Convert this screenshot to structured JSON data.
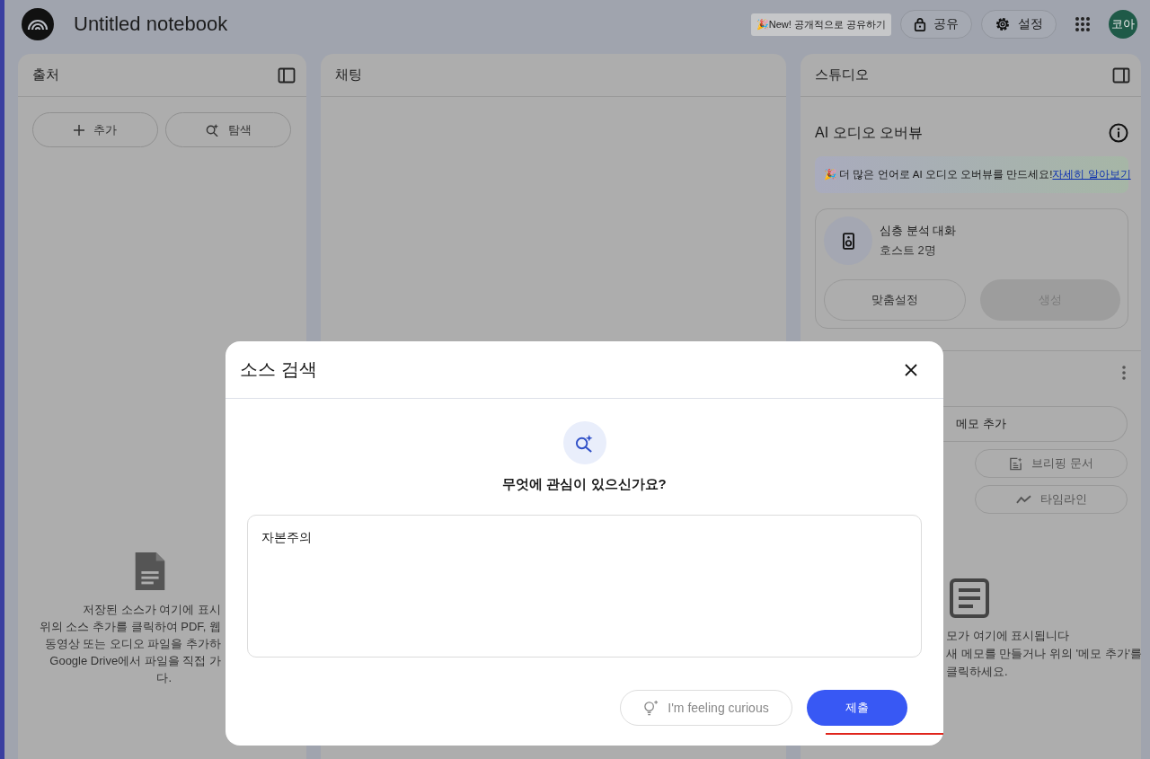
{
  "top_bar": {
    "title": "Untitled notebook",
    "badge": "🎉New! 공개적으로 공유하기",
    "share_button": "공유",
    "settings_button": "설정",
    "avatar": "코아"
  },
  "sources_panel": {
    "title": "출처",
    "buttons": [
      {
        "label": "추가",
        "kind": "add"
      },
      {
        "label": "탐색",
        "kind": "discover"
      }
    ],
    "empty_text": [
      "저장된 소스가 여기에 표시",
      "위의 소스 추가를 클릭하여 PDF, 웹",
      "동영상 또는 오디오 파일을 추가하",
      "Google Drive에서 파일을 직접 가",
      "다."
    ]
  },
  "chat_panel": {
    "title": "채팅"
  },
  "studio_panel": {
    "title": "스튜디오",
    "audio_overview": {
      "title": "AI 오디오 오버뷰",
      "banner": "🎉 더 많은 언어로 AI 오디오 오버뷰를 만드세요!",
      "banner_link": "자세히 알아보기",
      "card_title": "심층 분석 대화",
      "card_subtitle": "호스트 2명",
      "buttons": [
        {
          "label": "맞춤설정",
          "kind": "outline",
          "disabled": false
        },
        {
          "label": "생성",
          "kind": "filled",
          "disabled": true
        }
      ]
    },
    "notes": {
      "add_button": "메모 추가",
      "actions": [
        {
          "label": "브리핑 문서",
          "kind": "briefing"
        },
        {
          "label": "타임라인",
          "kind": "timeline"
        }
      ],
      "empty_text": [
        "모가 여기에 표시됩니다",
        "새 메모를 만들거나 위의 '메모 추가'를",
        "클릭하세요."
      ]
    }
  },
  "dialog": {
    "title": "소스 검색",
    "question": "무엇에 관심이 있으신가요?",
    "query": "자본주의",
    "curious_button": "I'm feeling curious",
    "submit_button": "제출"
  }
}
